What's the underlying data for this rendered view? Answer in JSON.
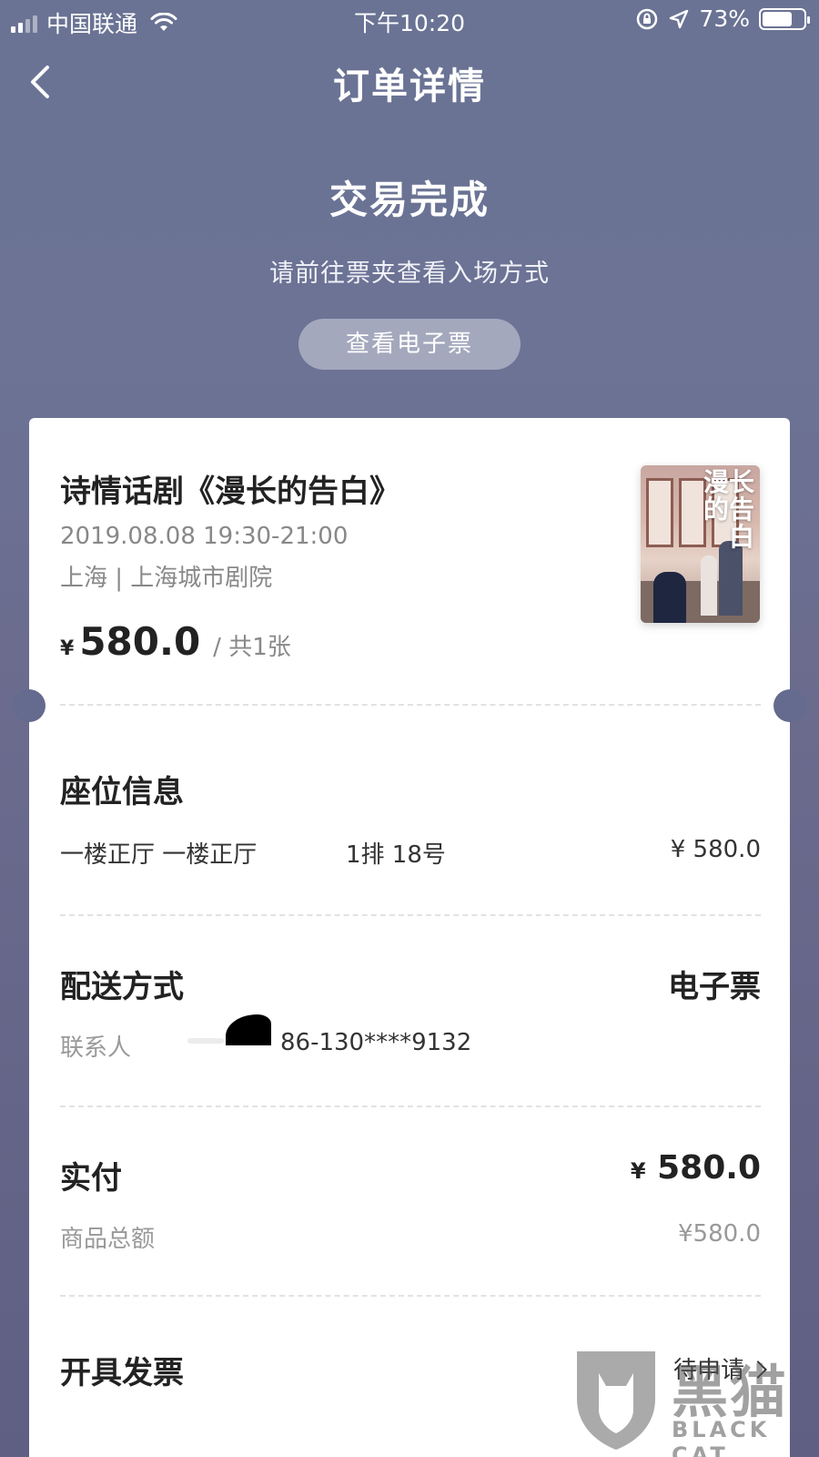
{
  "status_bar": {
    "carrier": "中国联通",
    "time": "下午10:20",
    "battery": "73%",
    "battery_level": 0.73,
    "signal_bars": 2
  },
  "nav": {
    "title": "订单详情",
    "back_icon": "chevron-left-icon"
  },
  "hero": {
    "status": "交易完成",
    "hint": "请前往票夹查看入场方式",
    "button": "查看电子票"
  },
  "show": {
    "title": "诗情话剧《漫长的告白》",
    "datetime": "2019.08.08 19:30-21:00",
    "venue": "上海 | 上海城市剧院",
    "currency": "¥",
    "price": "580.0",
    "quantity": "/ 共1张",
    "poster_title": "漫长的告白"
  },
  "seat": {
    "title": "座位信息",
    "area": "一楼正厅 一楼正厅",
    "position": "1排 18号",
    "price": "¥ 580.0"
  },
  "delivery": {
    "title": "配送方式",
    "method": "电子票",
    "contact_label": "联系人",
    "phone": "86-130****9132"
  },
  "payment": {
    "title": "实付",
    "currency": "¥",
    "paid": "580.0",
    "subtotal_label": "商品总额",
    "subtotal": "¥580.0"
  },
  "invoice": {
    "title": "开具发票",
    "status": "待申请"
  },
  "watermark": {
    "text": "黑猫",
    "sub": "BLACK CAT"
  }
}
